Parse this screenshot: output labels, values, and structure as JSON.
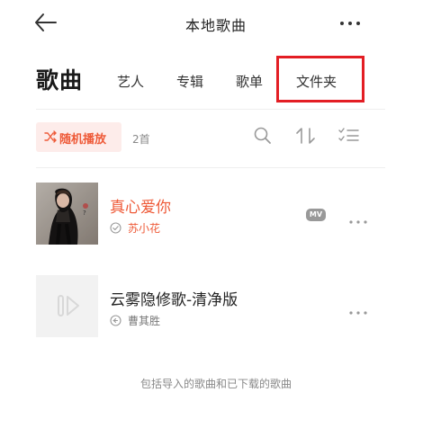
{
  "header": {
    "title": "本地歌曲"
  },
  "tabs": {
    "main_label": "歌曲",
    "items": [
      "艺人",
      "专辑",
      "歌单",
      "文件夹"
    ],
    "highlight_color": "#e31e24"
  },
  "toolbar": {
    "shuffle_label": "随机播放",
    "count_label": "2首",
    "accent_color": "#ee5a38",
    "icons": [
      "search-icon",
      "sort-icon",
      "multi-select-icon"
    ]
  },
  "songs": [
    {
      "title": "真心爱你",
      "artist": "苏小花",
      "badge": "MV",
      "active": true
    },
    {
      "title": "云雾隐修歌-清净版",
      "artist": "曹其胜",
      "active": false
    }
  ],
  "footer": {
    "note": "包括导入的歌曲和已下载的歌曲"
  }
}
